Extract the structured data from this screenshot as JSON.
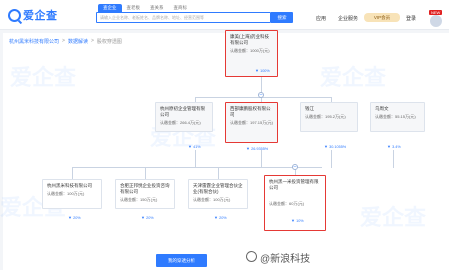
{
  "brand": {
    "name": "爱企查",
    "accent": "#2f7bff",
    "highlight": "#e53935"
  },
  "search": {
    "tabs": [
      "查企业",
      "查老板",
      "查关系",
      "查商标"
    ],
    "placeholder": "请输入企业名称、老板姓名、品牌名称、地址、经营范围等",
    "button": "搜索"
  },
  "nav": {
    "app": "应用",
    "vip": "VIP会员",
    "new_badge": "NEW",
    "login": "登录",
    "corp": "企业服务"
  },
  "breadcrumb": [
    "杭州黑米科技有限公司",
    "数据解读",
    "股权穿透图"
  ],
  "top_node": {
    "name": "康美(上海)药业科技有限公司",
    "cap": "认缴金额：1000万(元)",
    "pct": "100%"
  },
  "mid_nodes": [
    {
      "name": "杭州原初企业管理有限公司",
      "cap": "认缴金额：266.4万(元)",
      "pct": "41%"
    },
    {
      "name": "西部康鹏股权有限公司",
      "cap": "认缴金额：197.15万(元)",
      "pct": "26.9355%"
    },
    {
      "name": "钱江",
      "cap": "认缴金额：195.2万(元)",
      "pct": "30.1055%"
    },
    {
      "name": "乌周文",
      "cap": "认缴金额：55.15万(元)",
      "pct": "3.4%"
    }
  ],
  "bottom_nodes": [
    {
      "name": "杭州黑米科技有限公司",
      "cap": "认缴金额：100万(元)",
      "pct": "20%"
    },
    {
      "name": "合肥正邦悦企业投资咨询有限公司",
      "cap": "认缴金额：150万(元)",
      "pct": "20%"
    },
    {
      "name": "天津雷霆企业管理合伙企业(有限合伙)",
      "cap": "认缴金额：100万(元)",
      "pct": "20%"
    },
    {
      "name": "杭州黑一米投资管理有限公司",
      "cap": "认缴金额：60万(元)",
      "pct": "10%"
    }
  ],
  "bottom_button": "我的穿透分析",
  "watermark": "@新浪科技",
  "bg_mark": "爱企查"
}
